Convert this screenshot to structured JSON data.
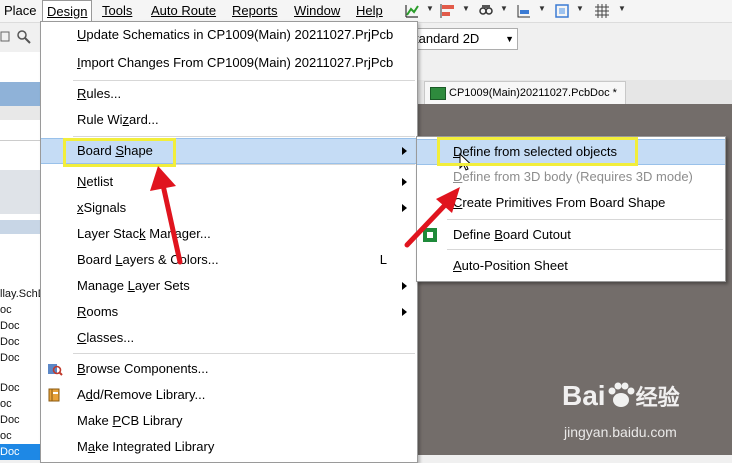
{
  "menubar": {
    "items": [
      {
        "label": "Place",
        "key": "P"
      },
      {
        "label": "Design",
        "key": "D"
      },
      {
        "label": "Tools",
        "key": "T"
      },
      {
        "label": "Auto Route",
        "key": "A"
      },
      {
        "label": "Reports",
        "key": "R"
      },
      {
        "label": "Window",
        "key": "W"
      },
      {
        "label": "Help",
        "key": "H"
      }
    ],
    "active": "Design"
  },
  "toolbar": {
    "view_select": "tandard 2D",
    "icons": [
      "interactive-routing-icon",
      "align-icon",
      "find-icon",
      "dimension-icon",
      "room-icon",
      "grid-icon"
    ]
  },
  "document_tab": {
    "label": "CP1009(Main)20211027.PcbDoc *"
  },
  "left_panel": {
    "files": [
      "llay.SchD",
      "oc",
      "Doc",
      "Doc",
      "Doc",
      "Doc",
      "oc",
      "Doc",
      "oc",
      "Doc"
    ]
  },
  "design_menu": {
    "items": [
      {
        "label": "Update Schematics in CP1009(Main) 20211027.PrjPcb",
        "u": 0
      },
      {
        "label": "Import Changes From CP1009(Main) 20211027.PrjPcb",
        "u": 0
      },
      {
        "label": "Rules...",
        "u": 0
      },
      {
        "label": "Rule Wizard...",
        "u": 7
      },
      {
        "label": "Board Shape",
        "u": 6,
        "submenu": true,
        "highlighted": true
      },
      {
        "label": "Netlist",
        "u": 0,
        "submenu": true
      },
      {
        "label": "xSignals",
        "u": 0,
        "submenu": true
      },
      {
        "label": "Layer Stack Manager...",
        "u": 10
      },
      {
        "label": "Board Layers & Colors...",
        "u": 6,
        "shortcut": "L"
      },
      {
        "label": "Manage Layer Sets",
        "u": 7,
        "submenu": true
      },
      {
        "label": "Rooms",
        "u": 0,
        "submenu": true
      },
      {
        "label": "Classes...",
        "u": 0
      },
      {
        "label": "Browse Components...",
        "u": 0,
        "icon": "browse-components-icon"
      },
      {
        "label": "Add/Remove Library...",
        "u": 1,
        "icon": "library-icon"
      },
      {
        "label": "Make PCB Library",
        "u": 5
      },
      {
        "label": "Make Integrated Library",
        "u": 1
      }
    ]
  },
  "board_shape_submenu": {
    "items": [
      {
        "label": "Define from selected objects",
        "u": 0,
        "highlighted": true
      },
      {
        "label": "Define from 3D body (Requires 3D mode)",
        "u": 0,
        "disabled": true
      },
      {
        "label": "Create Primitives From Board Shape",
        "u": 0
      },
      {
        "label": "Define Board Cutout",
        "u": 7,
        "icon": "board-cutout-icon"
      },
      {
        "label": "Auto-Position Sheet",
        "u": 0
      }
    ]
  },
  "watermark": {
    "brand": "Bai",
    "brand2": "经验",
    "url": "jingyan.baidu.com"
  },
  "colors": {
    "highlight": "#c5dcf5",
    "callout": "#f2ee3b",
    "arrow": "#e0141e",
    "canvas": "#736d6a"
  }
}
